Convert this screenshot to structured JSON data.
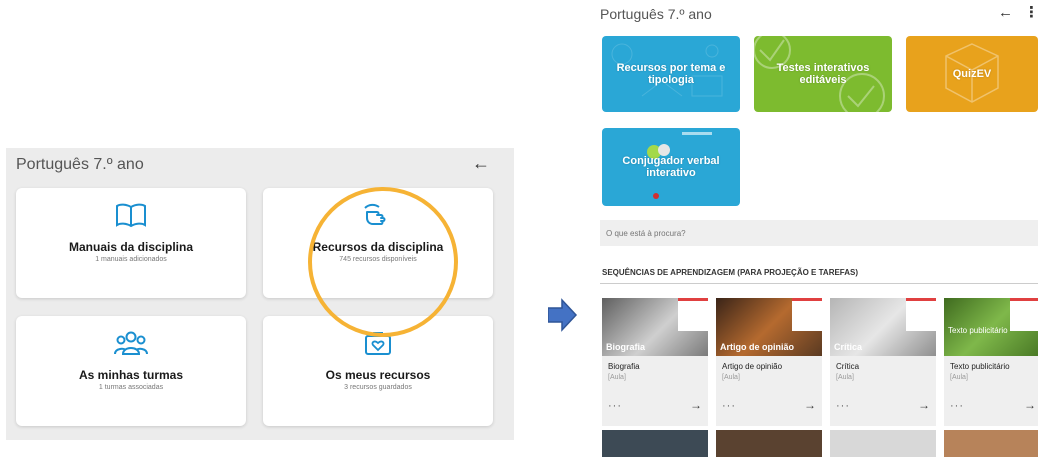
{
  "left": {
    "title": "Português 7.º ano",
    "back_icon": "arrow-left-icon",
    "cards": [
      {
        "title": "Manuais da disciplina",
        "subtitle": "1 manuais adicionados",
        "icon": "book-icon"
      },
      {
        "title": "Recursos da disciplina",
        "subtitle": "745 recursos disponíveis",
        "icon": "hand-pointer-icon"
      },
      {
        "title": "As minhas turmas",
        "subtitle": "1 turmas associadas",
        "icon": "group-icon"
      },
      {
        "title": "Os meus recursos",
        "subtitle": "3 recursos guardados",
        "icon": "briefcase-heart-icon"
      }
    ],
    "highlight_color": "#f6b335"
  },
  "arrow_color": "#4472c4",
  "right": {
    "title": "Português 7.º ano",
    "back_icon": "arrow-left-icon",
    "menu_icon": "more-vertical-icon",
    "tiles": [
      {
        "label": "Recursos por tema e tipologia",
        "color": "#2aa7d6"
      },
      {
        "label": "Testes interativos editáveis",
        "color": "#7dbb2f"
      },
      {
        "label": "QuizEV",
        "color": "#e8a21c"
      },
      {
        "label": "Conjugador verbal interativo",
        "color": "#2aa7d6"
      }
    ],
    "search_placeholder": "O que está à procura?",
    "section_title": "SEQUÊNCIAS DE APRENDIZAGEM (PARA PROJEÇÃO E TAREFAS)",
    "sequences": [
      {
        "thumb_label": "Biografia",
        "name": "Biografia",
        "type": "[Aula]"
      },
      {
        "thumb_label": "Artigo de opinião",
        "name": "Artigo de opinião",
        "type": "[Aula]"
      },
      {
        "thumb_label": "Crítica",
        "name": "Crítica",
        "type": "[Aula]"
      },
      {
        "thumb_label": "Texto publicitário",
        "name": "Texto publicitário",
        "type": "[Aula]"
      }
    ],
    "more_label": "···",
    "go_label": "→"
  }
}
